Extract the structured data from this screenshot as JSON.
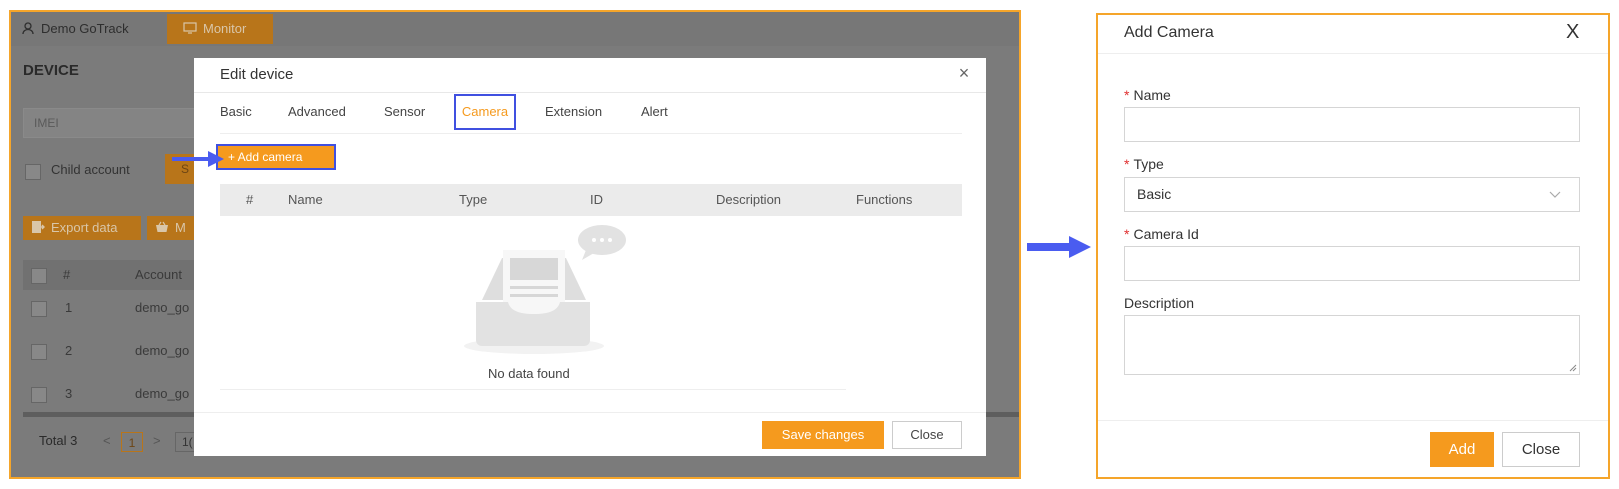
{
  "background": {
    "user_tab": "Demo GoTrack",
    "monitor_tab": "Monitor",
    "device_title": "DEVICE",
    "imei_placeholder": "IMEI",
    "child_account_label": "Child account",
    "search_button_partial": "S",
    "export_button": "Export data",
    "more_button": "M",
    "table_headers": [
      "#",
      "Account"
    ],
    "rows": [
      {
        "num": "1",
        "account": "demo_go"
      },
      {
        "num": "2",
        "account": "demo_go"
      },
      {
        "num": "3",
        "account": "demo_go"
      }
    ],
    "total_label": "Total 3",
    "current_page": "1",
    "page_size_partial": "1("
  },
  "edit_device": {
    "title": "Edit device",
    "close_glyph": "×",
    "tabs": [
      "Basic",
      "Advanced",
      "Sensor",
      "Camera",
      "Extension",
      "Alert"
    ],
    "active_tab": "Camera",
    "add_camera_button": "+ Add camera",
    "table_headers": [
      "#",
      "Name",
      "Type",
      "ID",
      "Description",
      "Functions"
    ],
    "empty_text": "No data found",
    "save_button": "Save changes",
    "close_button": "Close"
  },
  "add_camera": {
    "title": "Add Camera",
    "close_glyph": "X",
    "required_mark": "*",
    "name_label": "Name",
    "name_value": "",
    "type_label": "Type",
    "type_value": "Basic",
    "camera_id_label": "Camera Id",
    "camera_id_value": "",
    "description_label": "Description",
    "description_value": "",
    "add_button": "Add",
    "close_button": "Close"
  },
  "colors": {
    "accent": "#f59a1e",
    "highlight_border": "#4050e0",
    "frame_border": "#f5a52a",
    "arrow": "#4a5cf0"
  },
  "icons": [
    "user-icon",
    "monitor-icon",
    "export-icon",
    "cart-icon",
    "plus-icon",
    "empty-inbox-icon",
    "chevron-down-icon",
    "arrow-right-icon"
  ]
}
